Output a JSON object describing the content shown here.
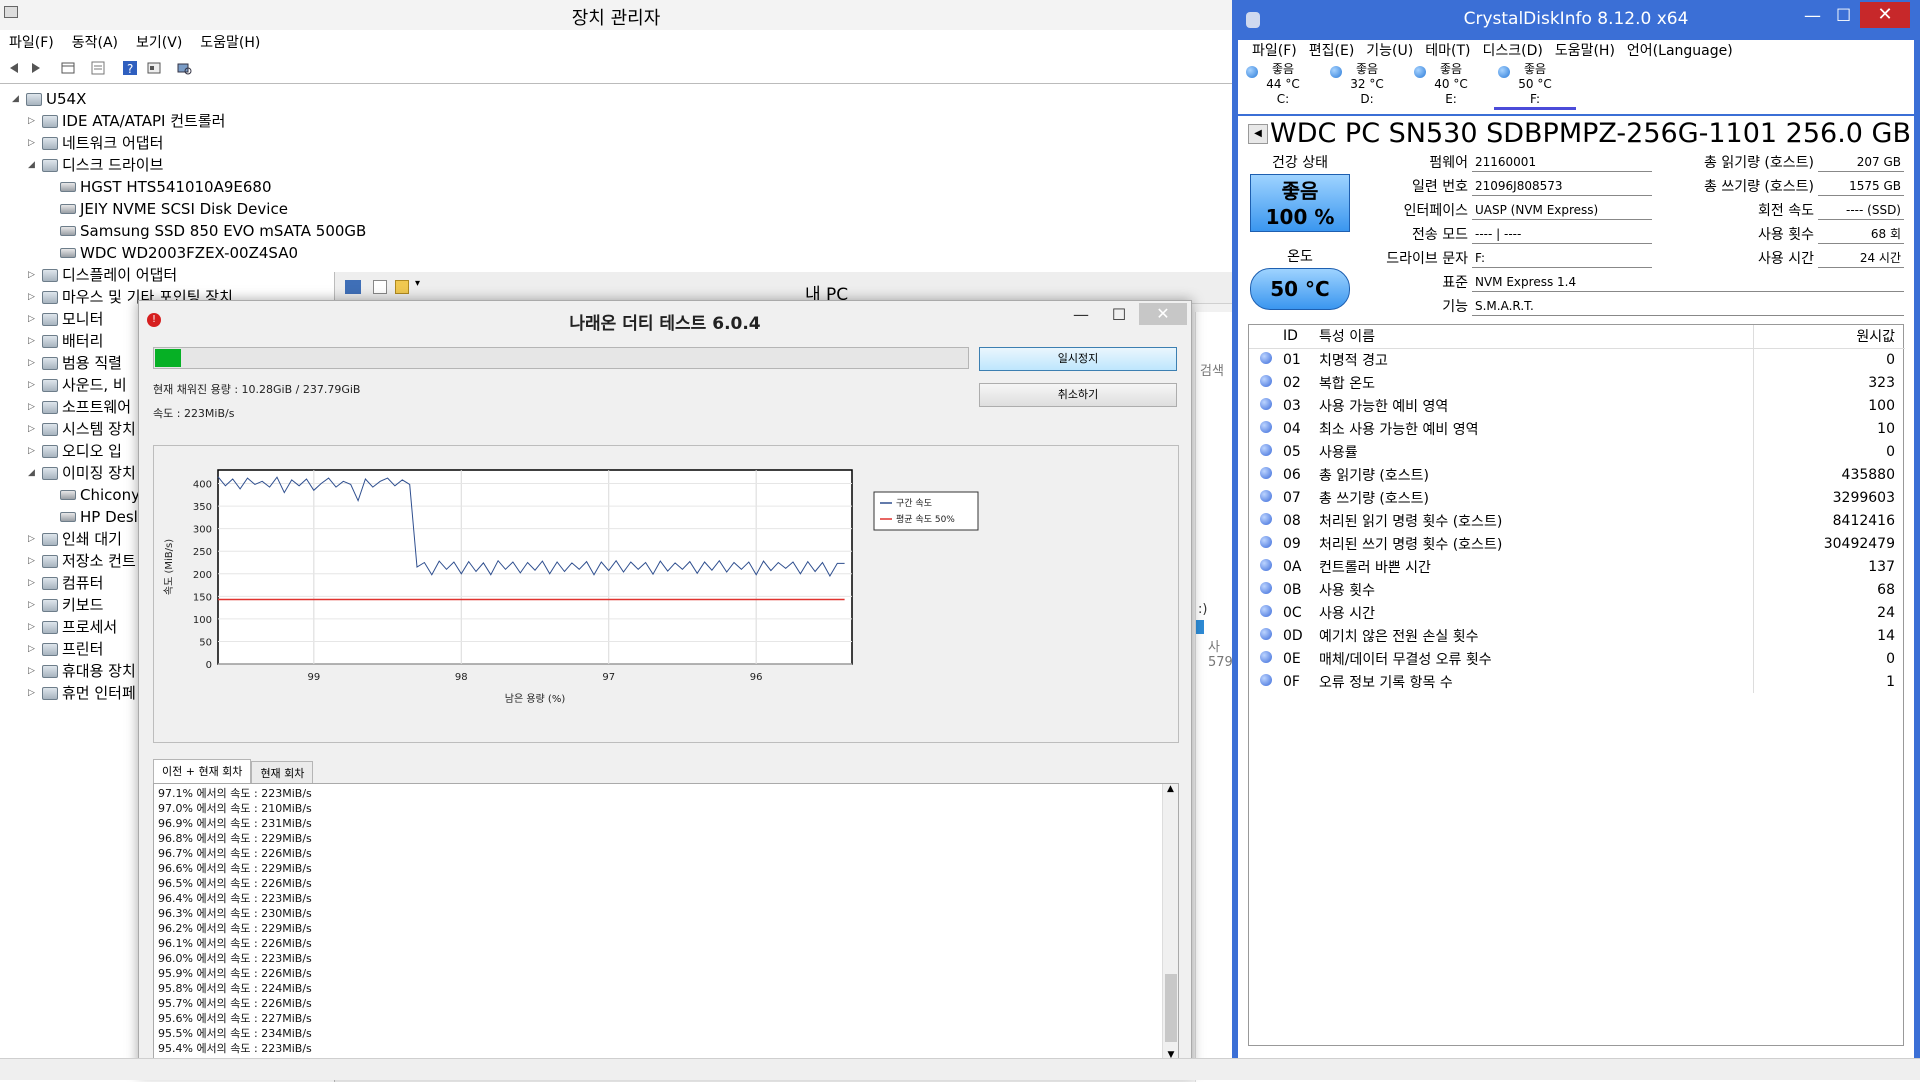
{
  "device_manager": {
    "title": "장치 관리자",
    "menu": [
      "파일(F)",
      "동작(A)",
      "보기(V)",
      "도움말(H)"
    ],
    "root": "U54X",
    "tree": [
      {
        "label": "IDE ATA/ATAPI 컨트롤러",
        "level": 1,
        "state": "collapsed"
      },
      {
        "label": "네트워크 어댑터",
        "level": 1,
        "state": "collapsed"
      },
      {
        "label": "디스크 드라이브",
        "level": 1,
        "state": "expanded"
      },
      {
        "label": "HGST HTS541010A9E680",
        "level": 2,
        "state": "leaf"
      },
      {
        "label": "JEIY NVME SCSI Disk Device",
        "level": 2,
        "state": "leaf"
      },
      {
        "label": "Samsung SSD 850 EVO mSATA 500GB",
        "level": 2,
        "state": "leaf"
      },
      {
        "label": "WDC WD2003FZEX-00Z4SA0",
        "level": 2,
        "state": "leaf"
      },
      {
        "label": "디스플레이 어댑터",
        "level": 1,
        "state": "collapsed"
      },
      {
        "label": "마우스 및 기타 포인팅 장치",
        "level": 1,
        "state": "collapsed"
      },
      {
        "label": "모니터",
        "level": 1,
        "state": "collapsed"
      },
      {
        "label": "배터리",
        "level": 1,
        "state": "collapsed"
      },
      {
        "label": "범용 직렬",
        "level": 1,
        "state": "collapsed"
      },
      {
        "label": "사운드, 비",
        "level": 1,
        "state": "collapsed"
      },
      {
        "label": "소프트웨어",
        "level": 1,
        "state": "collapsed"
      },
      {
        "label": "시스템 장치",
        "level": 1,
        "state": "collapsed"
      },
      {
        "label": "오디오 입",
        "level": 1,
        "state": "collapsed"
      },
      {
        "label": "이미징 장치",
        "level": 1,
        "state": "expanded"
      },
      {
        "label": "Chicony",
        "level": 2,
        "state": "leaf"
      },
      {
        "label": "HP Desl",
        "level": 2,
        "state": "leaf"
      },
      {
        "label": "인쇄 대기",
        "level": 1,
        "state": "collapsed"
      },
      {
        "label": "저장소 컨트",
        "level": 1,
        "state": "collapsed"
      },
      {
        "label": "컴퓨터",
        "level": 1,
        "state": "collapsed"
      },
      {
        "label": "키보드",
        "level": 1,
        "state": "collapsed"
      },
      {
        "label": "프로세서",
        "level": 1,
        "state": "collapsed"
      },
      {
        "label": "프린터",
        "level": 1,
        "state": "collapsed"
      },
      {
        "label": "휴대용 장치",
        "level": 1,
        "state": "collapsed"
      },
      {
        "label": "휴먼 인터페",
        "level": 1,
        "state": "collapsed"
      }
    ]
  },
  "explorer": {
    "title": "내 PC",
    "side_text_1": "검색",
    "side_text_2": ":)",
    "side_text_3": "사 579"
  },
  "dirty_test": {
    "title": "나래온 더티 테스트 6.0.4",
    "progress_fraction": 0.032,
    "filled_label": "현재 채워진 용량 : 10.28GiB / 237.79GiB",
    "speed_label": "속도 : 223MiB/s",
    "pause_button": "일시정지",
    "cancel_button": "취소하기",
    "tabs": [
      "이전 + 현재 회차",
      "현재 회차"
    ],
    "log": [
      "97.1% 에서의 속도 : 223MiB/s",
      "97.0% 에서의 속도 : 210MiB/s",
      "96.9% 에서의 속도 : 231MiB/s",
      "96.8% 에서의 속도 : 229MiB/s",
      "96.7% 에서의 속도 : 226MiB/s",
      "96.6% 에서의 속도 : 229MiB/s",
      "96.5% 에서의 속도 : 226MiB/s",
      "96.4% 에서의 속도 : 223MiB/s",
      "96.3% 에서의 속도 : 230MiB/s",
      "96.2% 에서의 속도 : 229MiB/s",
      "96.1% 에서의 속도 : 226MiB/s",
      "96.0% 에서의 속도 : 223MiB/s",
      "95.9% 에서의 속도 : 226MiB/s",
      "95.8% 에서의 속도 : 224MiB/s",
      "95.7% 에서의 속도 : 226MiB/s",
      "95.6% 에서의 속도 : 227MiB/s",
      "95.5% 에서의 속도 : 234MiB/s",
      "95.4% 에서의 속도 : 223MiB/s"
    ]
  },
  "chart_data": {
    "type": "line",
    "xlabel": "남은 용량 (%)",
    "ylabel": "속도 (MiB/s)",
    "xlim": [
      99.65,
      95.35
    ],
    "ylim": [
      0,
      430
    ],
    "xticks": [
      99,
      98,
      97,
      96
    ],
    "yticks": [
      0,
      50,
      100,
      150,
      200,
      250,
      300,
      350,
      400
    ],
    "grid": true,
    "legend_position": "top-right",
    "series": [
      {
        "name": "구간 속도",
        "color": "#2f4f8f",
        "x": [
          99.65,
          99.6,
          99.55,
          99.5,
          99.45,
          99.4,
          99.35,
          99.3,
          99.25,
          99.2,
          99.15,
          99.1,
          99.05,
          99.0,
          98.95,
          98.9,
          98.85,
          98.8,
          98.75,
          98.7,
          98.65,
          98.6,
          98.55,
          98.5,
          98.45,
          98.4,
          98.35,
          98.3,
          98.25,
          98.2,
          98.15,
          98.1,
          98.05,
          98.0,
          97.95,
          97.9,
          97.85,
          97.8,
          97.75,
          97.7,
          97.65,
          97.6,
          97.55,
          97.5,
          97.45,
          97.4,
          97.35,
          97.3,
          97.25,
          97.2,
          97.15,
          97.1,
          97.05,
          97.0,
          96.95,
          96.9,
          96.85,
          96.8,
          96.75,
          96.7,
          96.65,
          96.6,
          96.55,
          96.5,
          96.45,
          96.4,
          96.35,
          96.3,
          96.25,
          96.2,
          96.15,
          96.1,
          96.05,
          96.0,
          95.95,
          95.9,
          95.85,
          95.8,
          95.75,
          95.7,
          95.65,
          95.6,
          95.55,
          95.5,
          95.45,
          95.4
        ],
        "y": [
          415,
          395,
          410,
          388,
          412,
          398,
          405,
          392,
          414,
          380,
          408,
          395,
          410,
          385,
          400,
          412,
          392,
          405,
          398,
          362,
          410,
          392,
          405,
          412,
          395,
          408,
          398,
          215,
          225,
          198,
          228,
          210,
          226,
          200,
          227,
          205,
          224,
          198,
          229,
          210,
          226,
          202,
          225,
          208,
          228,
          200,
          226,
          205,
          224,
          210,
          227,
          198,
          226,
          207,
          229,
          204,
          226,
          210,
          225,
          199,
          228,
          206,
          224,
          210,
          227,
          201,
          226,
          208,
          229,
          204,
          225,
          210,
          226,
          198,
          228,
          207,
          225,
          212,
          226,
          200,
          227,
          205,
          225,
          195,
          223,
          223
        ]
      },
      {
        "name": "평균 속도 50%",
        "color": "#e0322f",
        "x": [
          99.65,
          95.4
        ],
        "y": [
          143,
          143
        ]
      }
    ]
  },
  "crystaldiskinfo": {
    "title": "CrystalDiskInfo 8.12.0 x64",
    "menu": [
      "파일(F)",
      "편집(E)",
      "기능(U)",
      "테마(T)",
      "디스크(D)",
      "도움말(H)",
      "언어(Language)"
    ],
    "drives": [
      {
        "status": "좋음",
        "temp": "44 °C",
        "letter": "C:"
      },
      {
        "status": "좋음",
        "temp": "32 °C",
        "letter": "D:"
      },
      {
        "status": "좋음",
        "temp": "40 °C",
        "letter": "E:"
      },
      {
        "status": "좋음",
        "temp": "50 °C",
        "letter": "F:"
      }
    ],
    "model": "WDC PC SN530 SDBPMPZ-256G-1101 256.0 GB",
    "health_label": "건강 상태",
    "health_status": "좋음",
    "health_percent": "100 %",
    "temp_label": "온도",
    "temp_value": "50 °C",
    "fields": {
      "firmware_label": "펌웨어",
      "firmware": "21160001",
      "serial_label": "일련 번호",
      "serial": "21096J808573",
      "interface_label": "인터페이스",
      "interface": "UASP (NVM Express)",
      "transfer_label": "전송 모드",
      "transfer": "---- | ----",
      "letter_label": "드라이브 문자",
      "letter": "F:",
      "standard_label": "표준",
      "standard": "NVM Express 1.4",
      "features_label": "기능",
      "features": "S.M.A.R.T.",
      "host_reads_label": "총 읽기량 (호스트)",
      "host_reads": "207 GB",
      "host_writes_label": "총 쓰기량 (호스트)",
      "host_writes": "1575 GB",
      "rotation_label": "회전 속도",
      "rotation": "---- (SSD)",
      "power_count_label": "사용 횟수",
      "power_count": "68 회",
      "power_hours_label": "사용 시간",
      "power_hours": "24 시간"
    },
    "smart_header": {
      "id": "ID",
      "name": "특성 이름",
      "raw": "원시값"
    },
    "smart": [
      {
        "id": "01",
        "name": "치명적 경고",
        "raw": "0"
      },
      {
        "id": "02",
        "name": "복합 온도",
        "raw": "323"
      },
      {
        "id": "03",
        "name": "사용 가능한 예비 영역",
        "raw": "100"
      },
      {
        "id": "04",
        "name": "최소 사용 가능한 예비 영역",
        "raw": "10"
      },
      {
        "id": "05",
        "name": "사용률",
        "raw": "0"
      },
      {
        "id": "06",
        "name": "총 읽기량 (호스트)",
        "raw": "435880"
      },
      {
        "id": "07",
        "name": "총 쓰기량 (호스트)",
        "raw": "3299603"
      },
      {
        "id": "08",
        "name": "처리된 읽기 명령 횟수 (호스트)",
        "raw": "8412416"
      },
      {
        "id": "09",
        "name": "처리된 쓰기 명령 횟수 (호스트)",
        "raw": "30492479"
      },
      {
        "id": "0A",
        "name": "컨트롤러 바쁜 시간",
        "raw": "137"
      },
      {
        "id": "0B",
        "name": "사용 횟수",
        "raw": "68"
      },
      {
        "id": "0C",
        "name": "사용 시간",
        "raw": "24"
      },
      {
        "id": "0D",
        "name": "예기치 않은 전원 손실 횟수",
        "raw": "14"
      },
      {
        "id": "0E",
        "name": "매체/데이터 무결성 오류 횟수",
        "raw": "0"
      },
      {
        "id": "0F",
        "name": "오류 정보 기록 항목 수",
        "raw": "1"
      }
    ]
  }
}
